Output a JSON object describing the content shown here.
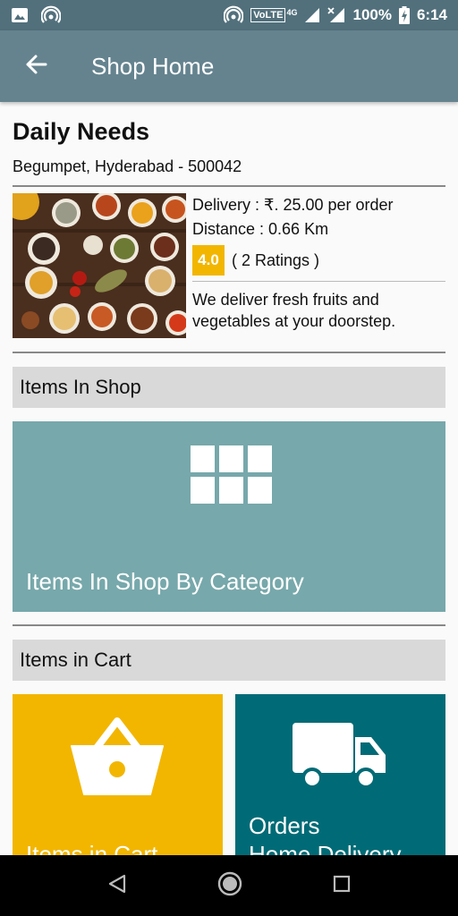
{
  "status_bar": {
    "battery": "100%",
    "time": "6:14",
    "network": "VoLTE",
    "network_type": "4G",
    "icons": [
      "image-icon",
      "hotspot-icon",
      "hotspot-icon",
      "signal-icon",
      "no-signal-icon",
      "battery-charging-icon"
    ]
  },
  "app_bar": {
    "title": "Shop Home",
    "back_icon": "arrow-left-icon"
  },
  "shop": {
    "name": "Daily Needs",
    "address": "Begumpet, Hyderabad - 500042",
    "delivery": "Delivery : ₹. 25.00 per order",
    "distance": "Distance : 0.66 Km",
    "rating": "4.0",
    "rating_count": "( 2 Ratings )",
    "description": "We deliver fresh fruits and vegetables at your doorstep."
  },
  "sections": {
    "items_in_shop": "Items In Shop",
    "items_in_cart": "Items in Cart"
  },
  "tiles": {
    "category": {
      "label": "Items In Shop By Category",
      "icon": "grid-icon",
      "color": "#77a8ab"
    },
    "cart": {
      "label": "Items in Cart",
      "icon": "basket-icon",
      "color": "#f2b600"
    },
    "orders": {
      "label_line1": "Orders",
      "label_line2": "Home Delivery",
      "icon": "truck-icon",
      "color": "#006b76"
    }
  },
  "nav": {
    "back": "back-icon",
    "home": "home-icon",
    "recents": "recents-icon"
  },
  "colors": {
    "status_bar": "#52707c",
    "app_bar": "#65838f",
    "rating_badge": "#f2b600"
  }
}
